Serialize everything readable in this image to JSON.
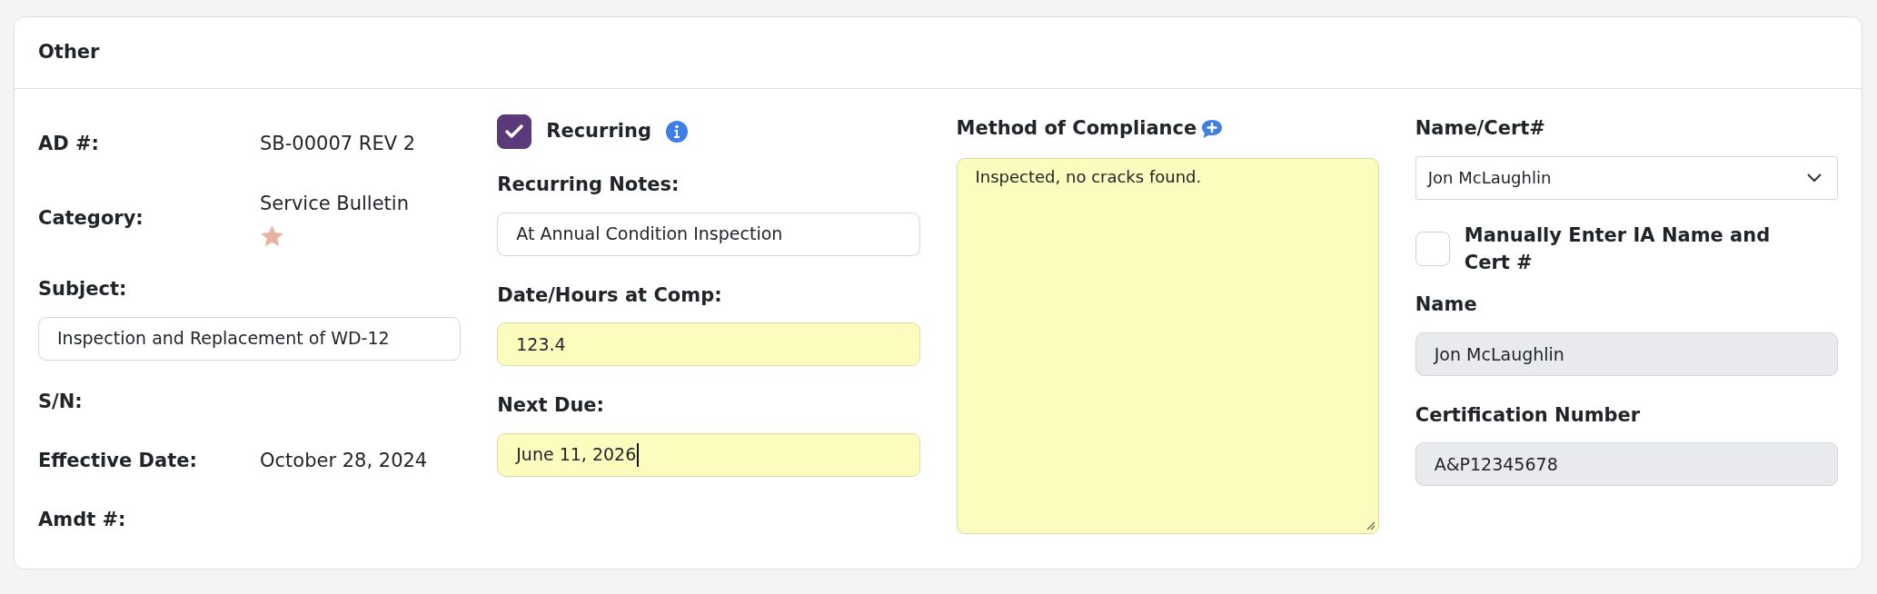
{
  "card": {
    "title": "Other"
  },
  "details": [
    {
      "kind": "text",
      "label": "AD #:",
      "value": "SB-00007 REV 2"
    },
    {
      "kind": "starred",
      "label": "Category:",
      "value": "Service Bulletin"
    },
    {
      "kind": "field",
      "label": "Subject:",
      "value": "Inspection and Replacement of WD-12"
    },
    {
      "kind": "blank",
      "label": "S/N:"
    },
    {
      "kind": "text",
      "label": "Effective Date:",
      "value": "October 28, 2024"
    },
    {
      "kind": "blank",
      "label": "Amdt #:"
    }
  ],
  "recurring": {
    "label": "Recurring",
    "checked": true
  },
  "recurring_fields": [
    {
      "label": "Recurring Notes:",
      "value": "At Annual Condition Inspection",
      "highlighted": false,
      "focused": false
    },
    {
      "label": "Date/Hours at Comp:",
      "value": "123.4",
      "highlighted": true,
      "focused": false
    },
    {
      "label": "Next Due:",
      "value": "June 11, 2026",
      "highlighted": true,
      "focused": true
    }
  ],
  "compliance": {
    "label": "Method of Compliance",
    "value": "Inspected, no cracks found.",
    "highlighted": true
  },
  "signer": {
    "label": "Name/Cert#",
    "value": "Jon McLaughlin"
  },
  "manual_entry": {
    "label": "Manually Enter IA Name and Cert #",
    "checked": false
  },
  "signer_fields": [
    {
      "label": "Name",
      "value": "Jon McLaughlin",
      "readonly": true
    },
    {
      "label": "Certification Number",
      "value": "A&P12345678",
      "readonly": true
    }
  ]
}
